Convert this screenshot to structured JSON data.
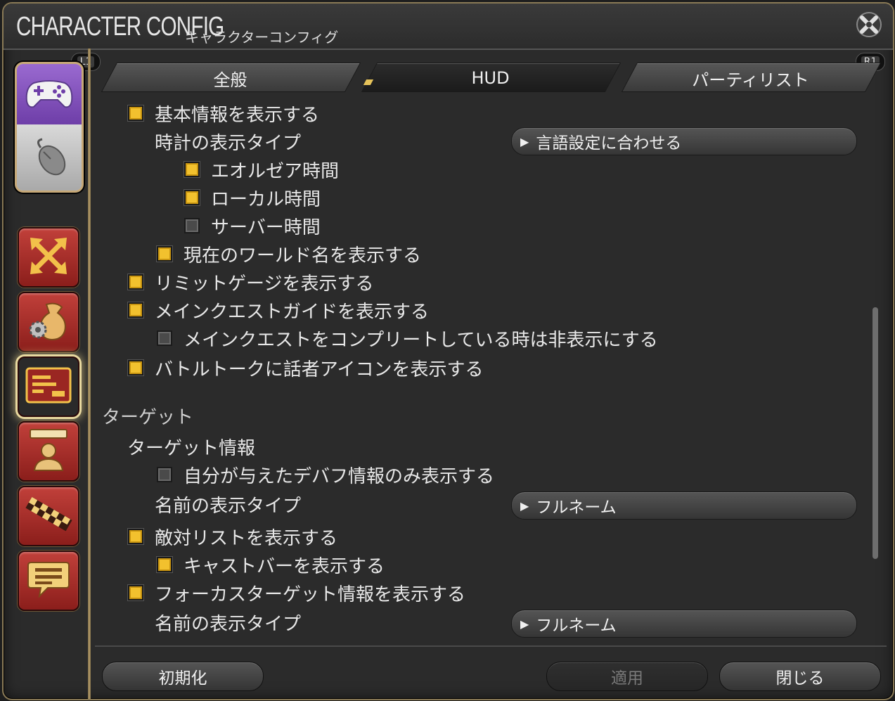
{
  "window": {
    "title_en": "CHARACTER CONFIG",
    "title_jp": "キャラクターコンフィグ"
  },
  "badges": {
    "left": "L1",
    "right": "R1"
  },
  "tabs": [
    {
      "label": "全般",
      "active": false
    },
    {
      "label": "HUD",
      "active": true
    },
    {
      "label": "パーティリスト",
      "active": false
    }
  ],
  "sidebar": {
    "device": {
      "top": "gamepad-icon",
      "bottom": "mouse-icon"
    },
    "categories": [
      {
        "icon": "arrows-icon",
        "selected": false
      },
      {
        "icon": "bag-gear-icon",
        "selected": false
      },
      {
        "icon": "hud-card-icon",
        "selected": true
      },
      {
        "icon": "character-profile-icon",
        "selected": false
      },
      {
        "icon": "checker-pattern-icon",
        "selected": false
      },
      {
        "icon": "chat-bubble-icon",
        "selected": false
      }
    ]
  },
  "options": {
    "basic_info": {
      "label": "基本情報を表示する",
      "checked": true
    },
    "clock_type_label": "時計の表示タイプ",
    "clock_type_value": "言語設定に合わせる",
    "eorzea_time": {
      "label": "エオルゼア時間",
      "checked": true
    },
    "local_time": {
      "label": "ローカル時間",
      "checked": true
    },
    "server_time": {
      "label": "サーバー時間",
      "checked": false
    },
    "world_name": {
      "label": "現在のワールド名を表示する",
      "checked": true
    },
    "limit_gauge": {
      "label": "リミットゲージを表示する",
      "checked": true
    },
    "msq_guide": {
      "label": "メインクエストガイドを表示する",
      "checked": true
    },
    "msq_hide": {
      "label": "メインクエストをコンプリートしている時は非表示にする",
      "checked": false
    },
    "battle_talk": {
      "label": "バトルトークに話者アイコンを表示する",
      "checked": true
    },
    "target_section": "ターゲット",
    "target_info_label": "ターゲット情報",
    "own_debuffs": {
      "label": "自分が与えたデバフ情報のみ表示する",
      "checked": false
    },
    "name_type_label_1": "名前の表示タイプ",
    "name_type_value_1": "フルネーム",
    "enmity_list": {
      "label": "敵対リストを表示する",
      "checked": true
    },
    "cast_bar": {
      "label": "キャストバーを表示する",
      "checked": true
    },
    "focus_target": {
      "label": "フォーカスターゲット情報を表示する",
      "checked": true
    },
    "name_type_label_2": "名前の表示タイプ",
    "name_type_value_2": "フルネーム"
  },
  "footer": {
    "reset": "初期化",
    "apply": "適用",
    "close": "閉じる"
  },
  "colors": {
    "checkbox_on": "#f2c12e",
    "category_red": "#a82e2a",
    "frame_gold": "#b79e6c"
  }
}
